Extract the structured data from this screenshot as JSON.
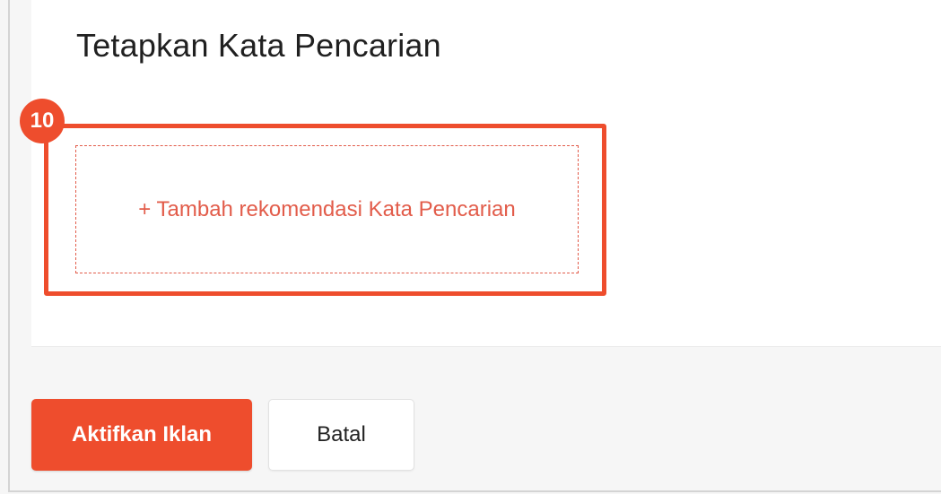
{
  "section": {
    "title": "Tetapkan Kata Pencarian",
    "add_keyword_label": "+ Tambah rekomendasi Kata Pencarian"
  },
  "annotation": {
    "step_number": "10"
  },
  "actions": {
    "activate_label": "Aktifkan Iklan",
    "cancel_label": "Batal"
  },
  "colors": {
    "accent": "#ee4d2d",
    "link": "#e25c4a",
    "background": "#f6f6f6",
    "card": "#ffffff"
  }
}
